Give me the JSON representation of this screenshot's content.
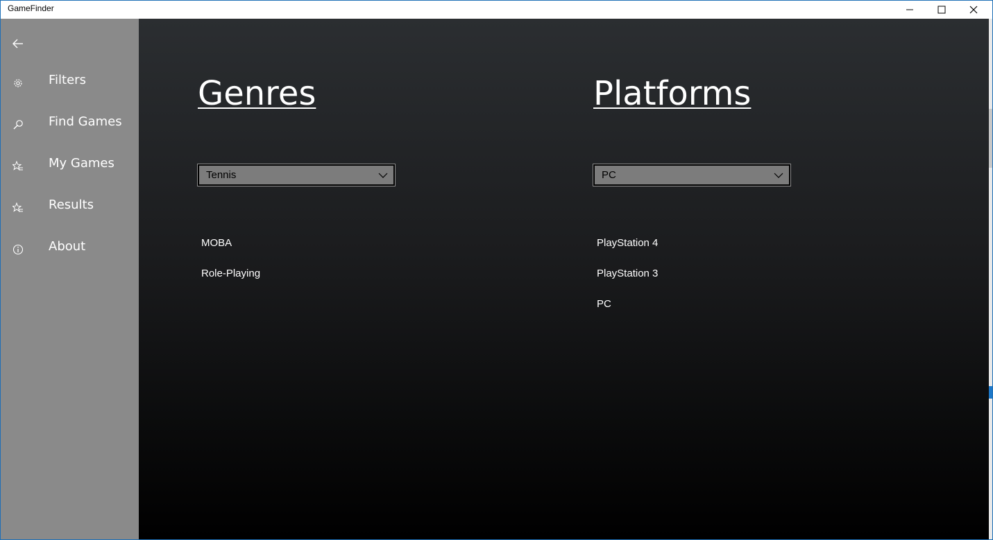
{
  "window": {
    "title": "GameFinder",
    "controls": [
      "minimize-icon",
      "maximize-icon",
      "close-icon"
    ]
  },
  "sidebar": {
    "back_icon": "arrow-left-icon",
    "items": [
      {
        "label": "Filters",
        "icon": "gear-icon"
      },
      {
        "label": "Find Games",
        "icon": "search-icon"
      },
      {
        "label": "My Games",
        "icon": "star-list-icon"
      },
      {
        "label": "Results",
        "icon": "star-list-icon"
      },
      {
        "label": "About",
        "icon": "info-icon"
      }
    ]
  },
  "genres": {
    "heading": "Genres",
    "selected": "Tennis",
    "items": [
      "MOBA",
      "Role-Playing"
    ]
  },
  "platforms": {
    "heading": "Platforms",
    "selected": "PC",
    "items": [
      "PlayStation 4",
      "PlayStation 3",
      "PC"
    ]
  },
  "colors": {
    "sidebar_bg": "#8a8a8a",
    "main_top": "#2b2e31",
    "main_bottom": "#000000",
    "combo_bg": "#7c7c7c"
  }
}
